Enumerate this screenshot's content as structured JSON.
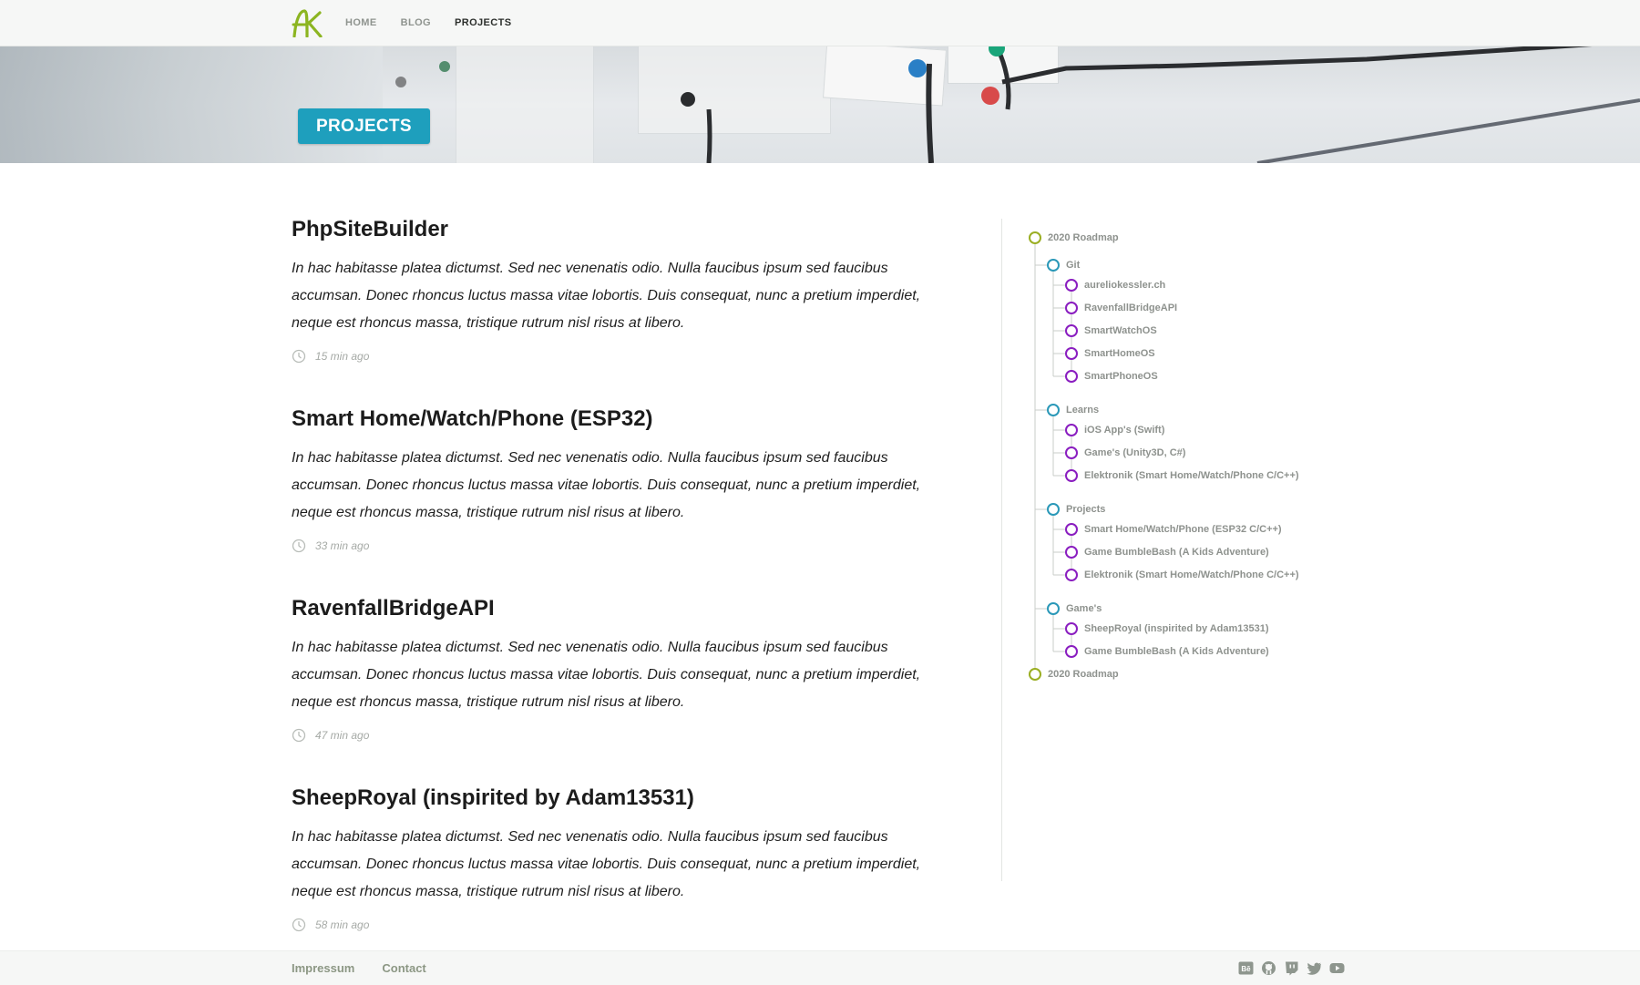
{
  "nav": {
    "logo_text": "AK",
    "links": [
      {
        "label": "HOME"
      },
      {
        "label": "BLOG"
      },
      {
        "label": "PROJECTS"
      }
    ]
  },
  "hero": {
    "title": "PROJECTS"
  },
  "posts": [
    {
      "title": "PhpSiteBuilder",
      "excerpt": "In hac habitasse platea dictumst. Sed nec venenatis odio. Nulla faucibus ipsum sed faucibus accumsan. Donec rhoncus luctus massa vitae lobortis. Duis consequat, nunc a pretium imperdiet, neque est rhoncus massa, tristique rutrum nisl risus at libero.",
      "time": "15 min ago"
    },
    {
      "title": "Smart Home/Watch/Phone (ESP32)",
      "excerpt": "In hac habitasse platea dictumst. Sed nec venenatis odio. Nulla faucibus ipsum sed faucibus accumsan. Donec rhoncus luctus massa vitae lobortis. Duis consequat, nunc a pretium imperdiet, neque est rhoncus massa, tristique rutrum nisl risus at libero.",
      "time": "33 min ago"
    },
    {
      "title": "RavenfallBridgeAPI",
      "excerpt": "In hac habitasse platea dictumst. Sed nec venenatis odio. Nulla faucibus ipsum sed faucibus accumsan. Donec rhoncus luctus massa vitae lobortis. Duis consequat, nunc a pretium imperdiet, neque est rhoncus massa, tristique rutrum nisl risus at libero.",
      "time": "47 min ago"
    },
    {
      "title": "SheepRoyal (inspirited by Adam13531)",
      "excerpt": "In hac habitasse platea dictumst. Sed nec venenatis odio. Nulla faucibus ipsum sed faucibus accumsan. Donec rhoncus luctus massa vitae lobortis. Duis consequat, nunc a pretium imperdiet, neque est rhoncus massa, tristique rutrum nisl risus at libero.",
      "time": "58 min ago"
    }
  ],
  "timeline": {
    "colors": {
      "root": "#9aae22",
      "group": "#2a98b8",
      "leaf": "#8a1ec0"
    },
    "root_top": "2020 Roadmap",
    "groups": [
      {
        "label": "Git",
        "items": [
          "aureliokessler.ch",
          "RavenfallBridgeAPI",
          "SmartWatchOS",
          "SmartHomeOS",
          "SmartPhoneOS"
        ]
      },
      {
        "label": "Learns",
        "items": [
          "iOS App's (Swift)",
          "Game's (Unity3D, C#)",
          "Elektronik (Smart Home/Watch/Phone C/C++)"
        ]
      },
      {
        "label": "Projects",
        "items": [
          "Smart Home/Watch/Phone (ESP32 C/C++)",
          "Game BumbleBash (A Kids Adventure)",
          "Elektronik (Smart Home/Watch/Phone C/C++)"
        ]
      },
      {
        "label": "Game's",
        "items": [
          "SheepRoyal (inspirited by Adam13531)",
          "Game BumbleBash (A Kids Adventure)"
        ]
      }
    ],
    "root_bottom": "2020 Roadmap"
  },
  "footer": {
    "links": [
      {
        "label": "Impressum"
      },
      {
        "label": "Contact"
      }
    ],
    "social": [
      "behance-icon",
      "github-icon",
      "twitch-icon",
      "twitter-icon",
      "youtube-icon"
    ]
  }
}
